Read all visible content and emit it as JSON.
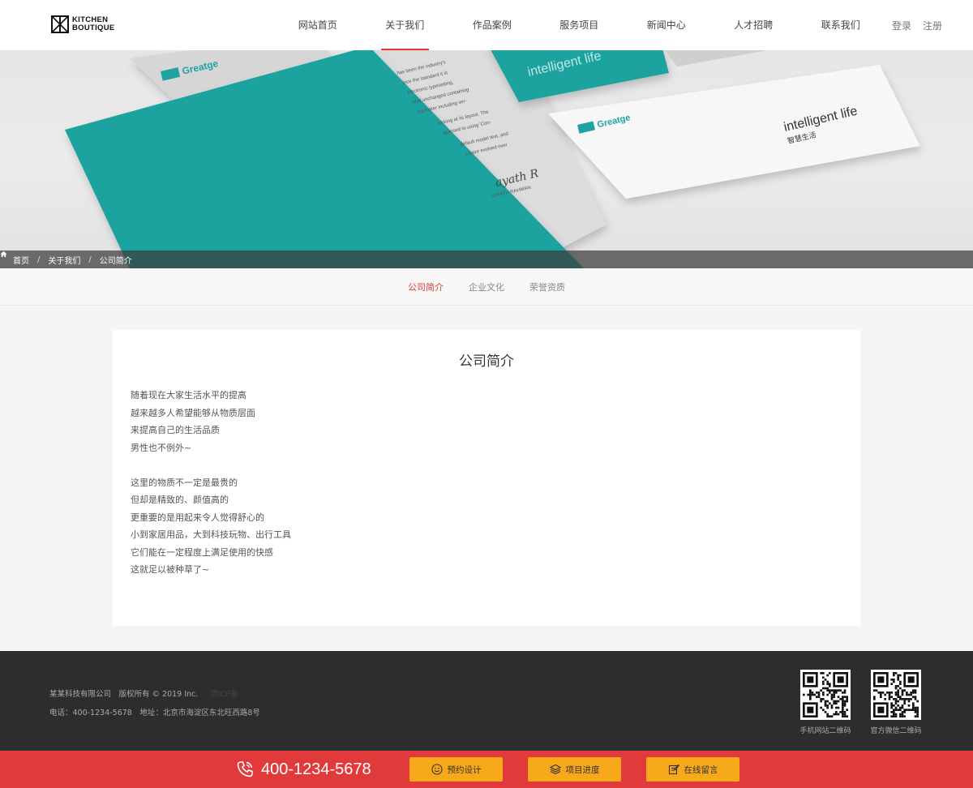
{
  "brand": {
    "line1": "KITCHEN",
    "line2": "BOUTIQUE"
  },
  "nav": {
    "items": [
      {
        "label": "网站首页"
      },
      {
        "label": "关于我们"
      },
      {
        "label": "作品案例"
      },
      {
        "label": "服务项目"
      },
      {
        "label": "新闻中心"
      },
      {
        "label": "人才招聘"
      },
      {
        "label": "联系我们"
      }
    ],
    "active_index": 1,
    "login": "登录",
    "register": "注册"
  },
  "banner": {
    "card_logo": "Greatge",
    "card_tagline": "intelligent life",
    "card_tagline_cn": "智慧生活",
    "letter_signature": "ayath R",
    "letter_name": "SAYATH RAHMAN",
    "letter_lines": [
      "has been the industry's",
      "ince the standard it is",
      "electronic typesetting,",
      "ntial unchanged containing",
      "ntpmaker including ver-",
      "looking at its layout. The",
      "opposed to using 'Con-",
      "default model text, and",
      "s have evolved over"
    ]
  },
  "breadcrumb": {
    "home": "首页",
    "section": "关于我们",
    "current": "公司简介"
  },
  "subtabs": {
    "items": [
      "公司简介",
      "企业文化",
      "荣誉资质"
    ],
    "active_index": 0
  },
  "content": {
    "title": "公司简介",
    "paragraph1": [
      "随着现在大家生活水平的提高",
      "越来越多人希望能够从物质层面",
      "来提高自己的生活品质",
      "男性也不例外~"
    ],
    "paragraph2": [
      "这里的物质不一定是最贵的",
      "但却是精致的、颜值高的",
      "更重要的是用起来令人觉得舒心的",
      "小到家居用品，大到科技玩物、出行工具",
      "它们能在一定程度上满足使用的快感",
      "这就足以被种草了~"
    ]
  },
  "footer": {
    "copyright": "某某科技有限公司　版权所有 © 2019 Inc.",
    "faint_text": "京ICP备",
    "contact": "电话：400-1234-5678　地址：北京市海淀区东北旺西路8号",
    "qr1_label": "手机网站二维码",
    "qr2_label": "官方微信二维码"
  },
  "bottombar": {
    "phone": "400-1234-5678",
    "buttons": [
      "预约设计",
      "项目进度",
      "在线留言"
    ]
  },
  "colors": {
    "accent": "#e03a3a",
    "teal": "#1ea3a0",
    "footer_bg": "#2d2d2d",
    "button": "#f7a81b"
  }
}
